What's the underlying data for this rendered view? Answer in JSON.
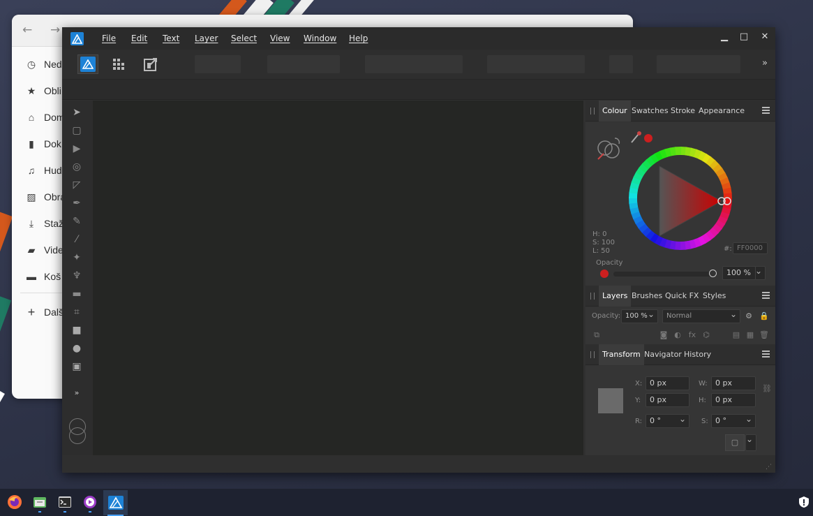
{
  "file_manager": {
    "sidebar": [
      {
        "icon": "clock-icon",
        "label": "Ned"
      },
      {
        "icon": "star-icon",
        "label": "Obli"
      },
      {
        "icon": "home-icon",
        "label": "Dom"
      },
      {
        "icon": "document-icon",
        "label": "Dok"
      },
      {
        "icon": "music-icon",
        "label": "Hud"
      },
      {
        "icon": "picture-icon",
        "label": "Obra"
      },
      {
        "icon": "download-icon",
        "label": "Staž"
      },
      {
        "icon": "video-icon",
        "label": "Vide"
      },
      {
        "icon": "trash-icon",
        "label": "Koš"
      },
      {
        "icon": "plus-icon",
        "label": "Dalš"
      }
    ]
  },
  "app": {
    "menu": [
      "File",
      "Edit",
      "Text",
      "Layer",
      "Select",
      "View",
      "Window",
      "Help"
    ],
    "window_controls": {
      "minimize": "▁",
      "maximize": "□",
      "close": "✕"
    },
    "toolbar_more": "»",
    "tools_more": "»"
  },
  "colour_panel": {
    "tabs": [
      "Colour",
      "Swatches",
      "Stroke",
      "Appearance"
    ],
    "active_tab": "Colour",
    "hsl": {
      "h": "H: 0",
      "s": "S: 100",
      "l": "L: 50"
    },
    "hex_label": "#:",
    "hex_value": "FF0000",
    "opacity_label": "Opacity",
    "opacity_value": "100 %",
    "colours": {
      "current": "#cc1f1f",
      "accent": "#3a8ee6"
    }
  },
  "layers_panel": {
    "tabs": [
      "Layers",
      "Brushes",
      "Quick FX",
      "Styles"
    ],
    "active_tab": "Layers",
    "opacity_label": "Opacity:",
    "opacity_value": "100 %",
    "blend_mode": "Normal"
  },
  "transform_panel": {
    "tabs": [
      "Transform",
      "Navigator",
      "History"
    ],
    "active_tab": "Transform",
    "x_label": "X:",
    "x_value": "0 px",
    "y_label": "Y:",
    "y_value": "0 px",
    "w_label": "W:",
    "w_value": "0 px",
    "h_label": "H:",
    "h_value": "0 px",
    "r_label": "R:",
    "r_value": "0 °",
    "s_label": "S:",
    "s_value": "0 °"
  },
  "taskbar": {
    "apps": [
      "firefox-icon",
      "files-icon",
      "terminal-icon",
      "media-player-icon",
      "affinity-designer-icon"
    ],
    "tray": [
      "shield-icon"
    ]
  }
}
